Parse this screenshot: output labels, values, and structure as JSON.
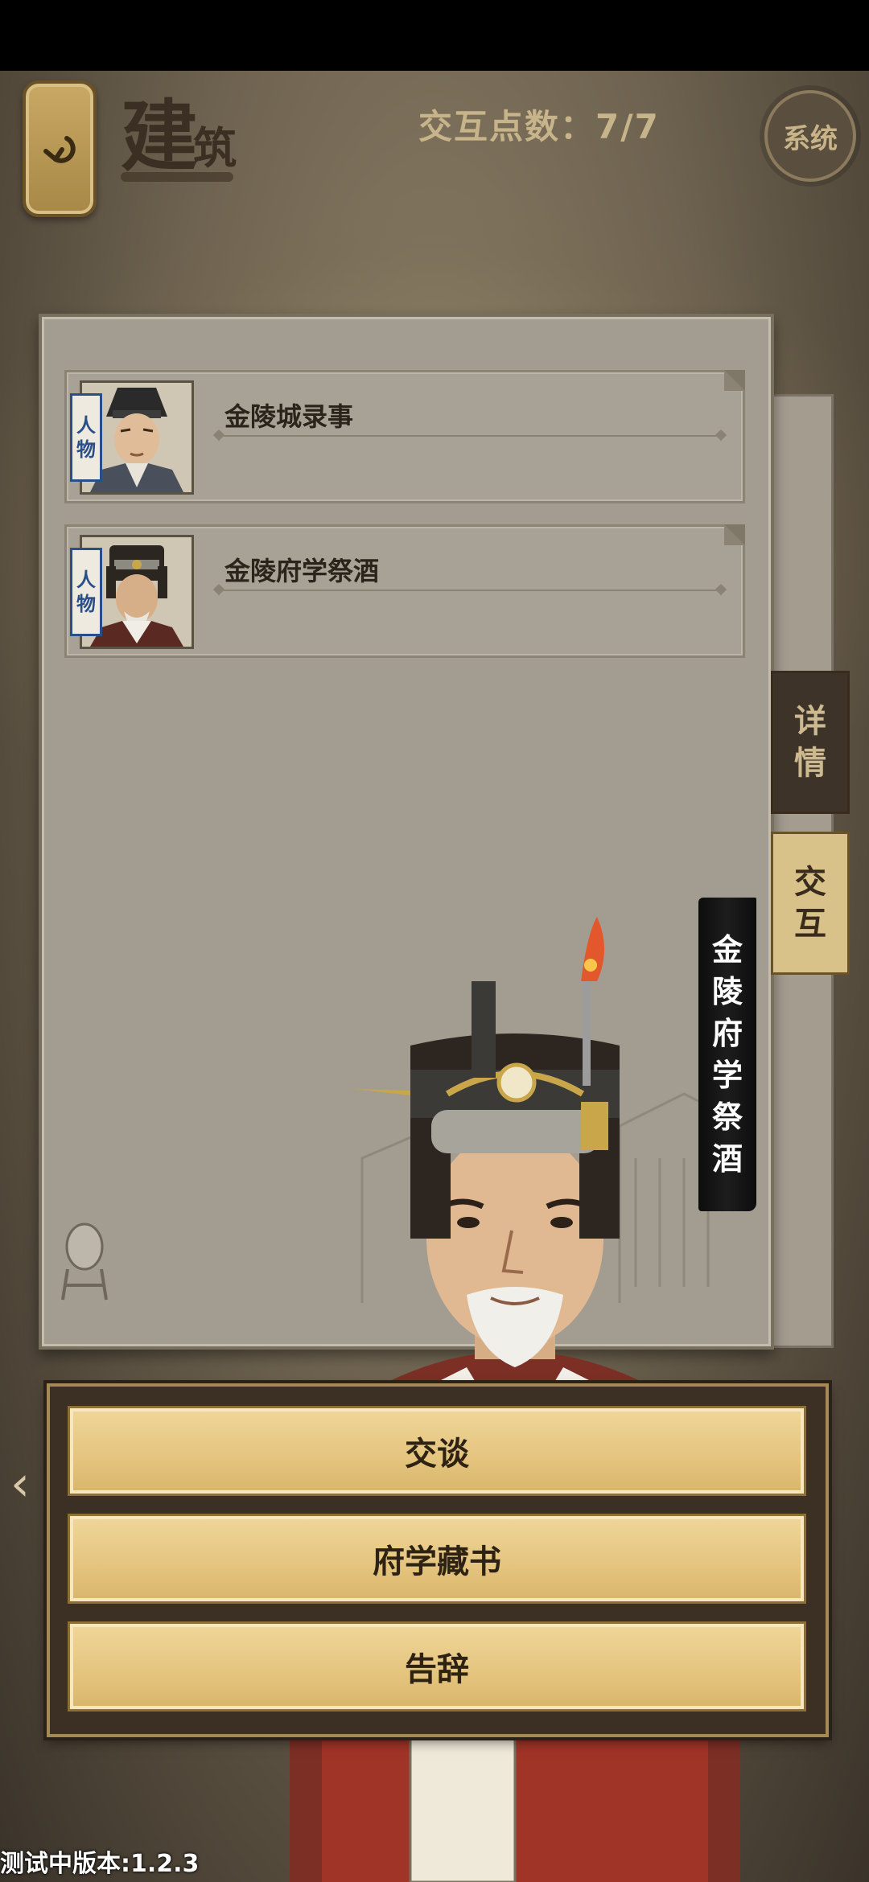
{
  "header": {
    "back_icon": "return-arrow-icon",
    "title_big": "建",
    "title_small": "筑",
    "interact_points": "交互点数：7/7",
    "system_label": "系统"
  },
  "cards": [
    {
      "tag": [
        "人",
        "物"
      ],
      "name": "金陵城录事",
      "avatar": "official-portrait-young"
    },
    {
      "tag": [
        "人",
        "物"
      ],
      "name": "金陵府学祭酒",
      "avatar": "official-portrait-elder"
    }
  ],
  "side_tabs": {
    "details": [
      "详",
      "情"
    ],
    "interact": [
      "交",
      "互"
    ]
  },
  "character": {
    "name_chars": [
      "金",
      "陵",
      "府",
      "学",
      "祭",
      "酒"
    ]
  },
  "dialog": {
    "options": [
      "交谈",
      "府学藏书",
      "告辞"
    ]
  },
  "footer": {
    "version": "测试中版本:1.2.3"
  },
  "colors": {
    "accent_gold": "#e4c47e",
    "panel_paper": "#a29c91",
    "text_dark": "#2a241b"
  }
}
